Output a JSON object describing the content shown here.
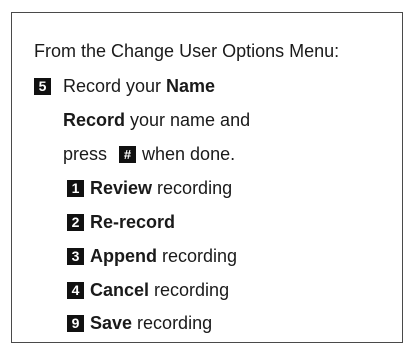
{
  "header": "From the Change User Options Menu:",
  "step": {
    "key": "5",
    "prefix": "Record your ",
    "bold": "Name"
  },
  "instruction": {
    "line1_bold": "Record",
    "line1_rest": " your name and",
    "line2_before": "press",
    "line2_key": "#",
    "line2_after": "when done."
  },
  "options": [
    {
      "key": "1",
      "bold": "Review",
      "rest": " recording"
    },
    {
      "key": "2",
      "bold": "Re-record",
      "rest": ""
    },
    {
      "key": "3",
      "bold": "Append",
      "rest": " recording"
    },
    {
      "key": "4",
      "bold": "Cancel",
      "rest": " recording"
    },
    {
      "key": "9",
      "bold": "Save",
      "rest": " recording"
    }
  ]
}
